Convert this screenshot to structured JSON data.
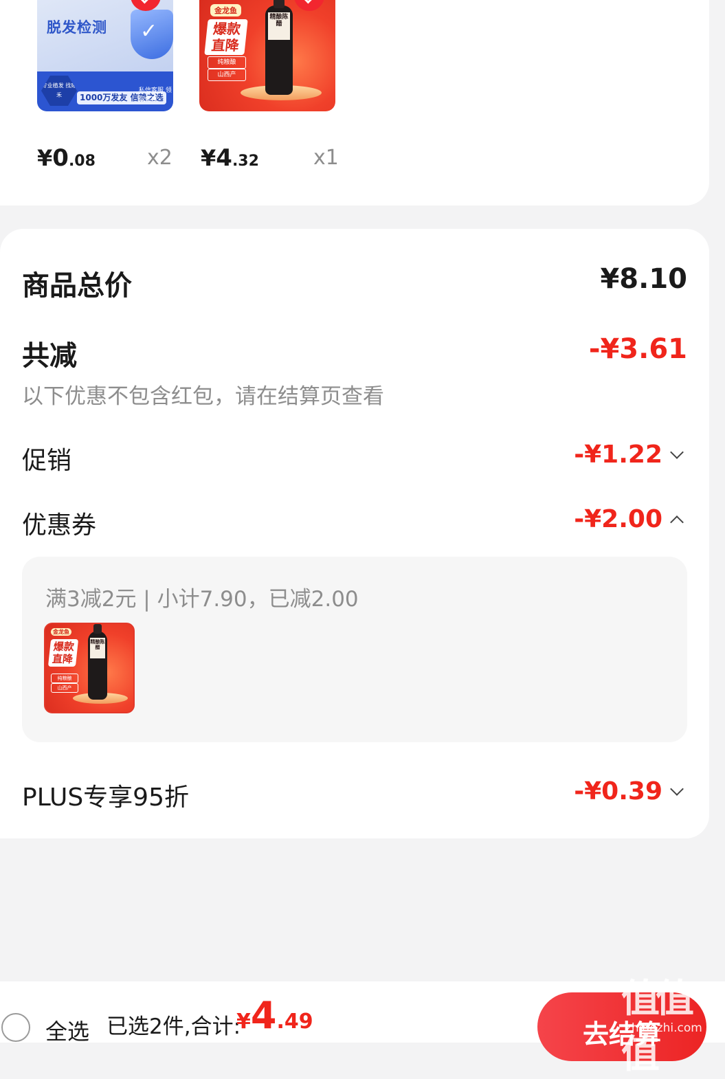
{
  "products": [
    {
      "name": "hair-test",
      "image_text": {
        "title": "脱发检测",
        "hex": "专业植发 找雍禾",
        "band": "1000万发友 信赖之选",
        "right": "私信客服 领取优惠"
      },
      "price": {
        "currency": "¥",
        "integer": "0",
        "decimal": ".08"
      },
      "qty": "x2"
    },
    {
      "name": "vinegar",
      "image_text": {
        "brand": "金龙鱼",
        "title": "爆款直降",
        "tag1": "纯粮酿",
        "tag2": "山西产",
        "label": "精酿陈醋"
      },
      "price": {
        "currency": "¥",
        "integer": "4",
        "decimal": ".32"
      },
      "qty": "x1"
    }
  ],
  "summary": {
    "total_label": "商品总价",
    "total_value": "¥8.10",
    "reduce_label": "共减",
    "reduce_value": "-¥3.61",
    "note": "以下优惠不包含红包，请在结算页查看",
    "promo_label": "促销",
    "promo_value": "-¥1.22",
    "coupon_label": "优惠券",
    "coupon_value": "-¥2.00",
    "coupon_detail": "满3减2元 | 小计7.90，已减2.00",
    "plus_label": "PLUS专享95折",
    "plus_value": "-¥0.39"
  },
  "bottom_bar": {
    "select_all": "全选",
    "selected_text": "已选2件,合计:",
    "total": {
      "currency": "¥",
      "integer": "4",
      "decimal": ".49"
    },
    "checkout": "去结算",
    "watermark": "值值值",
    "watermark_url": "zhidezhi.com"
  },
  "colors": {
    "accent": "#f0251b",
    "background": "#f3f3f4"
  }
}
